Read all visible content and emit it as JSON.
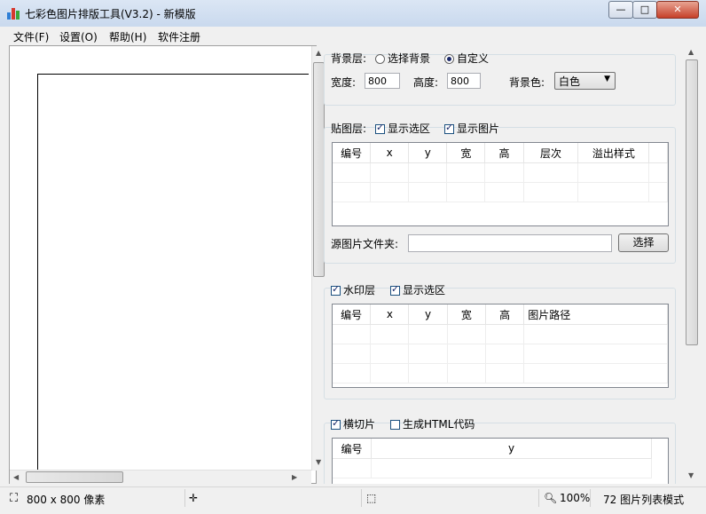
{
  "window": {
    "title": "七彩色图片排版工具(V3.2) - 新模版",
    "minimize_glyph": "—",
    "maximize_glyph": "□",
    "close_glyph": "✕"
  },
  "menu": [
    "文件(F)",
    "设置(O)",
    "帮助(H)",
    "软件注册"
  ],
  "background_layer": {
    "label": "背景层:",
    "option_select": "选择背景",
    "option_custom": "自定义",
    "selected": "自定义",
    "width_label": "宽度:",
    "width_value": "800",
    "height_label": "高度:",
    "height_value": "800",
    "color_label": "背景色:",
    "color_value": "白色"
  },
  "sticker_layer": {
    "label": "贴图层:",
    "show_area": "显示选区",
    "show_area_checked": true,
    "show_image": "显示图片",
    "show_image_checked": true,
    "columns": [
      "编号",
      "x",
      "y",
      "宽",
      "高",
      "层次",
      "溢出样式"
    ],
    "source_label": "源图片文件夹:",
    "source_value": "",
    "choose_button": "选择"
  },
  "watermark_layer": {
    "enabled_label": "水印层",
    "enabled": true,
    "show_area": "显示选区",
    "show_area_checked": true,
    "columns": [
      "编号",
      "x",
      "y",
      "宽",
      "高",
      "图片路径"
    ]
  },
  "slice_layer": {
    "enabled_label": "横切片",
    "enabled": true,
    "html_label": "生成HTML代码",
    "html_checked": false,
    "columns": [
      "编号",
      "y"
    ]
  },
  "statusbar": {
    "size_text": "800 x 800 像素",
    "zoom": "100%",
    "dpi_mode": "72 图片列表模式"
  },
  "icons": {
    "app": "app-logo-icon",
    "size": "canvas-size-icon",
    "move": "move-cross-icon",
    "select": "selection-icon",
    "zoom": "magnifier-icon"
  }
}
